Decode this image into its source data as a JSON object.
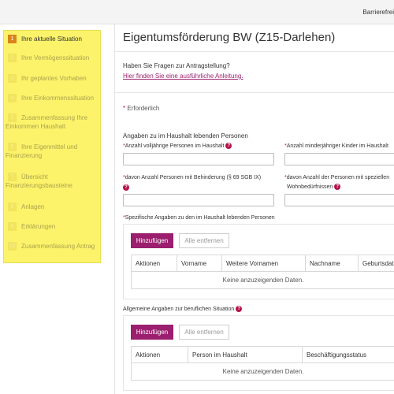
{
  "topbar": {
    "barrier_label": "Barrierefrei"
  },
  "sidebar": {
    "steps": [
      {
        "num": "1",
        "label": "Ihre aktuelle Situation"
      },
      {
        "num": "2",
        "label": "Ihre Vermögenssituation"
      },
      {
        "num": "3",
        "label": "Ihr geplantes Vorhaben"
      },
      {
        "num": "4",
        "label": "Ihre Einkommenssituation"
      },
      {
        "num": "5",
        "label": "Zusammenfassung Ihre",
        "label2": "Einkommen Haushalt"
      },
      {
        "num": "6",
        "label": "Ihre Eigenmittel und",
        "label2": "Finanzierung"
      },
      {
        "num": "7",
        "label": "Übersicht",
        "label2": "Finanzierungsbausteine"
      },
      {
        "num": "8",
        "label": "Anlagen"
      },
      {
        "num": "9",
        "label": "Erklärungen"
      },
      {
        "num": "10",
        "label": "Zusammenfassung Antrag"
      }
    ]
  },
  "main": {
    "title": "Eigentumsförderung BW (Z15-Darlehen)",
    "help_question": "Haben Sie Fragen zur Antragstellung?",
    "help_link": "Hier finden Sie eine ausführliche Anleitung.",
    "required_star": "*",
    "required_note": "Erforderlich",
    "household_section": "Angaben zu im Haushalt lebenden Personen",
    "fields": {
      "adults": "Anzahl volljährige Personen im Haushalt",
      "minors": "Anzahl minderjähriger Kinder im Haushalt",
      "disabled": "davon Anzahl Personen mit Behinderung (§ 69 SGB IX)",
      "special_needs_1": "davon Anzahl der Personen mit speziellen",
      "special_needs_2": "Wohnbedürfnissen"
    },
    "persons_section": "Spezifische Angaben zu den im Haushalt lebenden Personen",
    "add_label": "Hinzufügen",
    "remove_all_label": "Alle entfernen",
    "persons_table": {
      "columns": [
        "Aktionen",
        "Vorname",
        "Weitere Vornamen",
        "Nachname",
        "Geburtsdatum"
      ],
      "empty": "Keine anzuzeigenden Daten."
    },
    "job_section": "Allgemeine Angaben zur beruflichen Situation",
    "job_table": {
      "columns": [
        "Aktionen",
        "Person im Haushalt",
        "Beschäftigungsstatus"
      ],
      "empty": "Keine anzuzeigenden Daten."
    },
    "help_icon": "?"
  },
  "colors": {
    "accent": "#9b1f6e",
    "sidebar_bg": "#fdf36b",
    "active_step": "#d9851a",
    "required": "#b5134c"
  }
}
